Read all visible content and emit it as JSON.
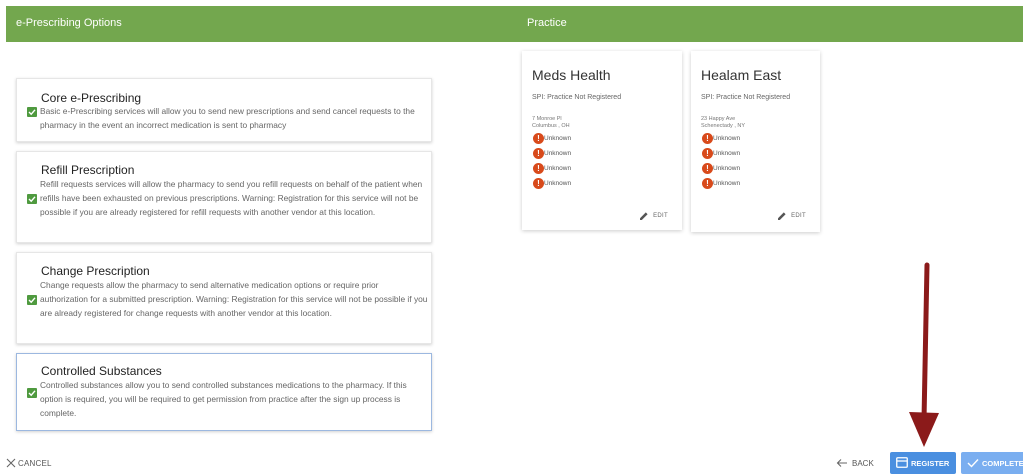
{
  "header": {
    "left_title": "e-Prescribing Options",
    "right_title": "Practice"
  },
  "options": [
    {
      "title": "Core e-Prescribing",
      "checked": true,
      "description": "Basic e-Prescribing services will allow you to send new prescriptions and send cancel requests to the pharmacy in the event an incorrect medication is sent to pharmacy"
    },
    {
      "title": "Refill Prescription",
      "checked": true,
      "description": "Refill requests services will allow the pharmacy to send you refill requests on behalf of the patient when refills have been exhausted on previous prescriptions. Warning: Registration for this service will not be possible if you are already registered for refill requests with another vendor at this location."
    },
    {
      "title": "Change Prescription",
      "checked": true,
      "description": "Change requests allow the pharmacy to send alternative medication options or require prior authorization for a submitted prescription. Warning: Registration for this service will not be possible if you are already registered for change requests with another vendor at this location."
    },
    {
      "title": "Controlled Substances",
      "checked": true,
      "description": "Controlled substances allow you to send controlled substances medications to the pharmacy. If this option is required, you will be required to get permission from practice after the sign up process is complete."
    }
  ],
  "practices": [
    {
      "name": "Meds Health",
      "spi": "SPI: Practice Not Registered",
      "address_line1": "7 Monroe Pl",
      "address_line2": "Columbus , OH",
      "statuses": [
        "Unknown",
        "Unknown",
        "Unknown",
        "Unknown"
      ],
      "edit_label": "EDIT"
    },
    {
      "name": "Healam East",
      "spi": "SPI: Practice Not Registered",
      "address_line1": "23 Happy Ave",
      "address_line2": "Schenectady , NY",
      "statuses": [
        "Unknown",
        "Unknown",
        "Unknown",
        "Unknown"
      ],
      "edit_label": "EDIT"
    }
  ],
  "footer": {
    "cancel_label": "CANCEL",
    "back_label": "BACK",
    "register_label": "REGISTER",
    "complete_label": "COMPLETE"
  },
  "colors": {
    "header_green": "#73a74e",
    "checkbox_green": "#4f9a3f",
    "status_red": "#d84a1b",
    "primary_blue": "#4a8fe0",
    "annotation_red": "#8b1a1a"
  },
  "icons": {
    "checkbox": "check-icon",
    "status": "exclamation-icon",
    "edit": "pencil-icon",
    "cancel": "close-icon",
    "back": "arrow-left-icon",
    "register": "card-icon",
    "complete": "check-icon"
  }
}
